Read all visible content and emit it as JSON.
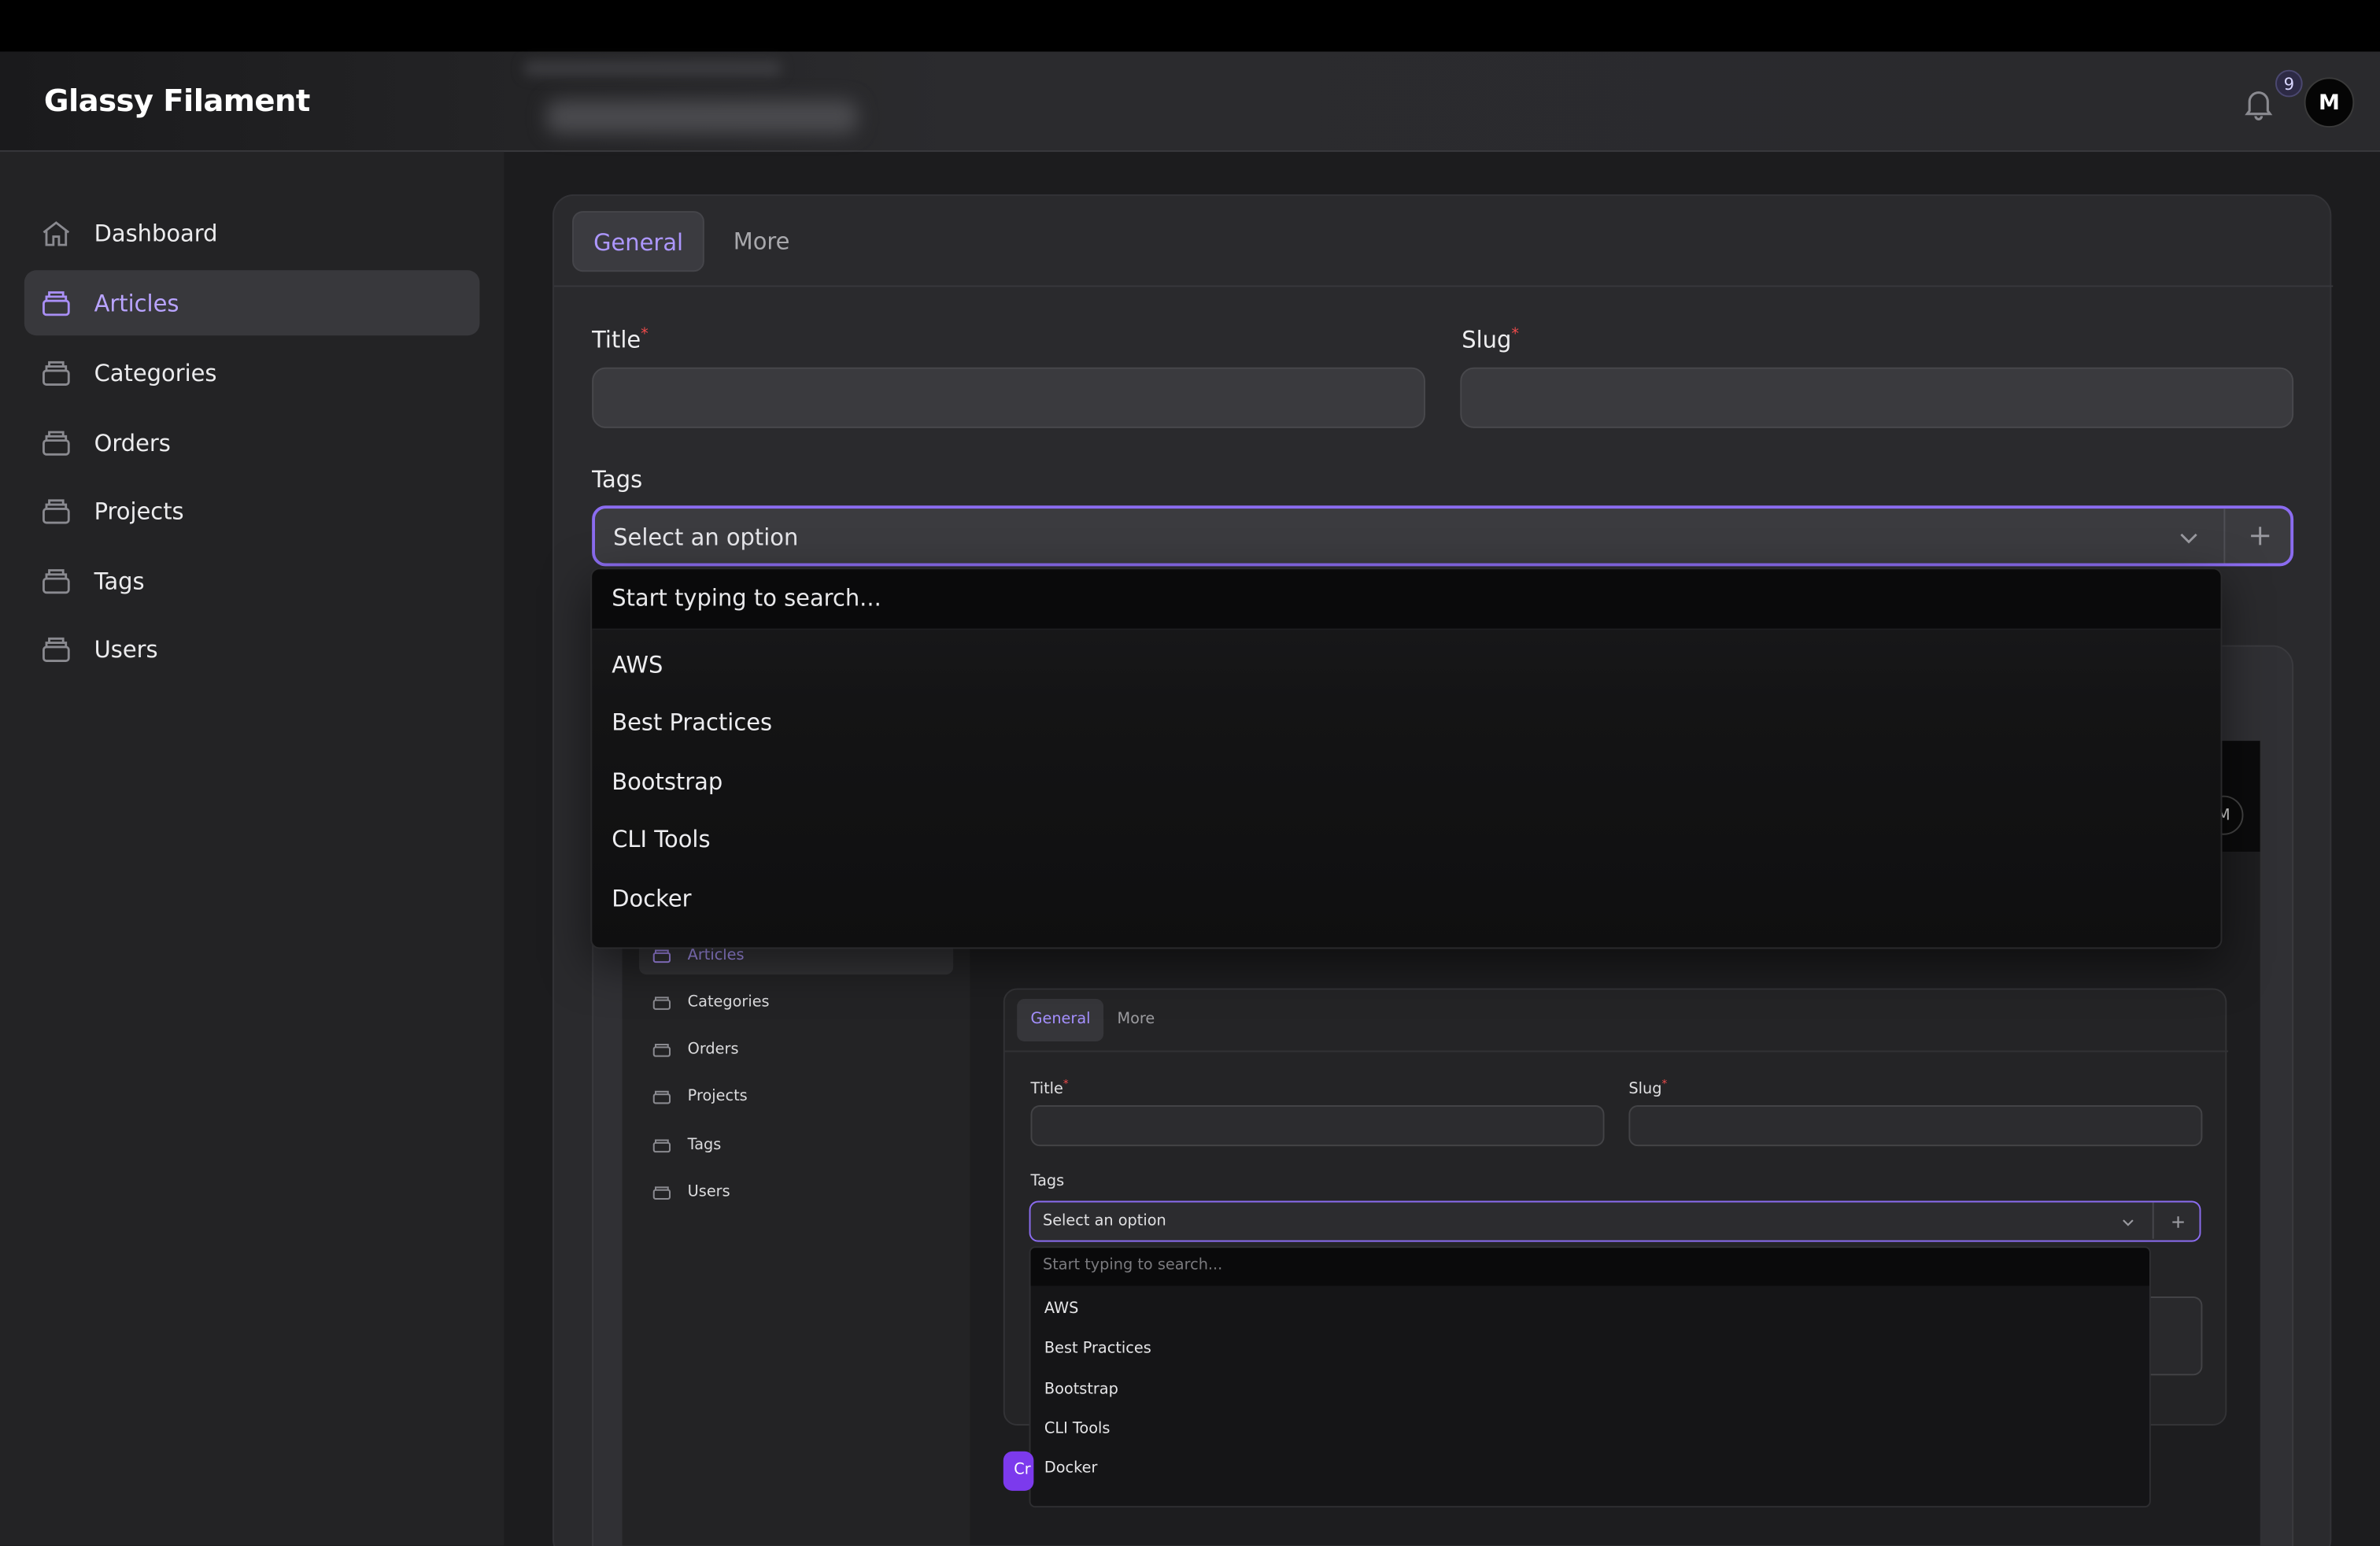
{
  "app": {
    "brand": "Glassy Filament"
  },
  "header": {
    "notifications_count": "9",
    "avatar_initial": "M"
  },
  "sidebar": {
    "items": [
      {
        "label": "Dashboard",
        "icon": "home-icon"
      },
      {
        "label": "Articles",
        "icon": "archive-box-icon",
        "active": true
      },
      {
        "label": "Categories",
        "icon": "archive-box-icon"
      },
      {
        "label": "Orders",
        "icon": "archive-box-icon"
      },
      {
        "label": "Projects",
        "icon": "archive-box-icon"
      },
      {
        "label": "Tags",
        "icon": "archive-box-icon"
      },
      {
        "label": "Users",
        "icon": "archive-box-icon"
      }
    ]
  },
  "form": {
    "tabs": [
      {
        "label": "General",
        "active": true
      },
      {
        "label": "More"
      }
    ],
    "title_label": "Title",
    "slug_label": "Slug",
    "tags_label": "Tags",
    "tags_placeholder": "Select an option"
  },
  "dropdown": {
    "search_placeholder": "Start typing to search...",
    "options": [
      "AWS",
      "Best Practices",
      "Bootstrap",
      "CLI Tools",
      "Docker"
    ]
  },
  "nested_preview": {
    "avatar_initial": "M",
    "sidebar": [
      "Articles",
      "Categories",
      "Orders",
      "Projects",
      "Tags",
      "Users"
    ],
    "tabs": [
      "General",
      "More"
    ],
    "title_label": "Title",
    "slug_label": "Slug",
    "tags_label": "Tags",
    "tags_placeholder": "Select an option",
    "search_placeholder": "Start typing to search...",
    "options": [
      "AWS",
      "Best Practices",
      "Bootstrap",
      "CLI Tools",
      "Docker"
    ],
    "button_fragment": "Cr"
  },
  "colors": {
    "accent": "#8b6cf0",
    "active_text": "#b9a4ff",
    "required": "#ef4b4b"
  }
}
